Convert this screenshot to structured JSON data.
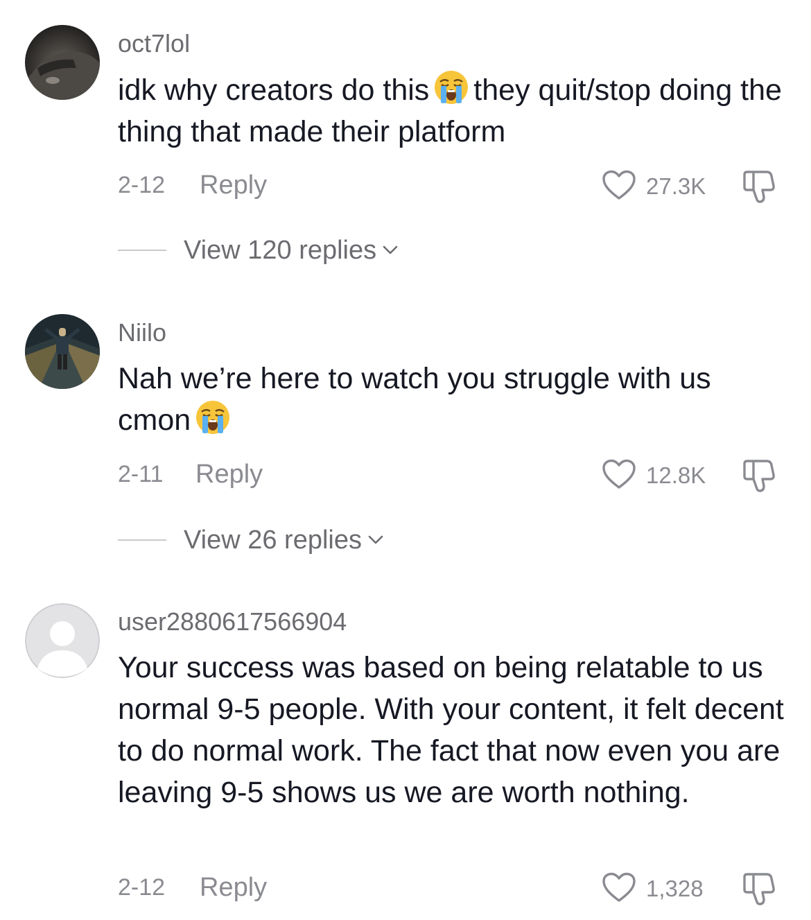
{
  "comments": [
    {
      "username": "oct7lol",
      "text_part1": "idk why creators do this",
      "emoji": "loudly-crying-face",
      "text_part2": "they quit/stop doing the thing that made their platform",
      "date": "2-12",
      "reply_label": "Reply",
      "likes": "27.3K",
      "view_replies": "View 120 replies"
    },
    {
      "username": "Niilo",
      "text_part1": "Nah we’re here to watch you struggle with us cmon",
      "emoji": "loudly-crying-face",
      "date": "2-11",
      "reply_label": "Reply",
      "likes": "12.8K",
      "view_replies": "View 26 replies"
    },
    {
      "username": "user2880617566904",
      "text_part1": "Your success was based on being relatable to us normal 9-5 people. With your content, it felt decent to do normal work. The fact that now even you are leaving 9-5 shows us we are worth nothing.",
      "date": "2-12",
      "reply_label": "Reply",
      "likes": "1,328"
    }
  ],
  "colors": {
    "text_primary": "#161823",
    "text_secondary": "#8a8b91",
    "username": "#6b6b70"
  }
}
